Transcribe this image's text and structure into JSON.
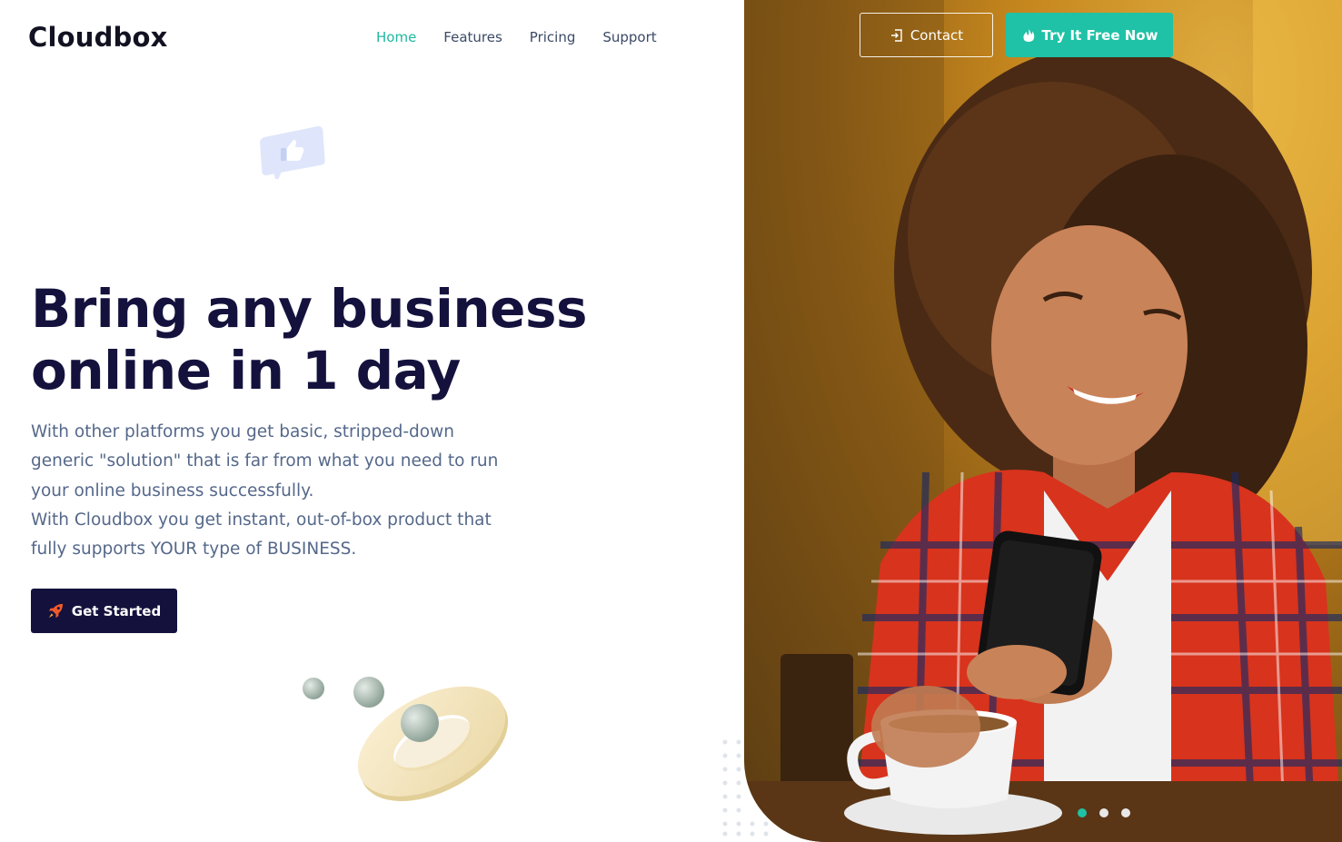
{
  "brand": {
    "name": "Cloudbox"
  },
  "nav": {
    "items": [
      {
        "label": "Home",
        "active": true
      },
      {
        "label": "Features",
        "active": false
      },
      {
        "label": "Pricing",
        "active": false
      },
      {
        "label": "Support",
        "active": false
      }
    ]
  },
  "header": {
    "contact_label": "Contact",
    "contact_icon": "sign-in-icon",
    "try_label": "Try It Free Now",
    "try_icon": "fire-icon"
  },
  "hero": {
    "title_line1": "Bring any business",
    "title_line2": "online in 1 day",
    "paragraph1_line1": "With other platforms you get basic, stripped-down",
    "paragraph1_line2": "generic \"solution\" that is far from what you need to run",
    "paragraph1_line3": "your online business successfully.",
    "paragraph2_line1": "With Cloudbox you get instant, out-of-box product that",
    "paragraph2_line2": "fully supports YOUR type of BUSINESS.",
    "cta_label": "Get Started",
    "cta_icon": "rocket-icon"
  },
  "slider": {
    "count": 3,
    "active_index": 0
  },
  "colors": {
    "accent": "#1fc2a6",
    "dark": "#14123d",
    "text": "#55688a",
    "nav_text": "#3b4a66"
  }
}
